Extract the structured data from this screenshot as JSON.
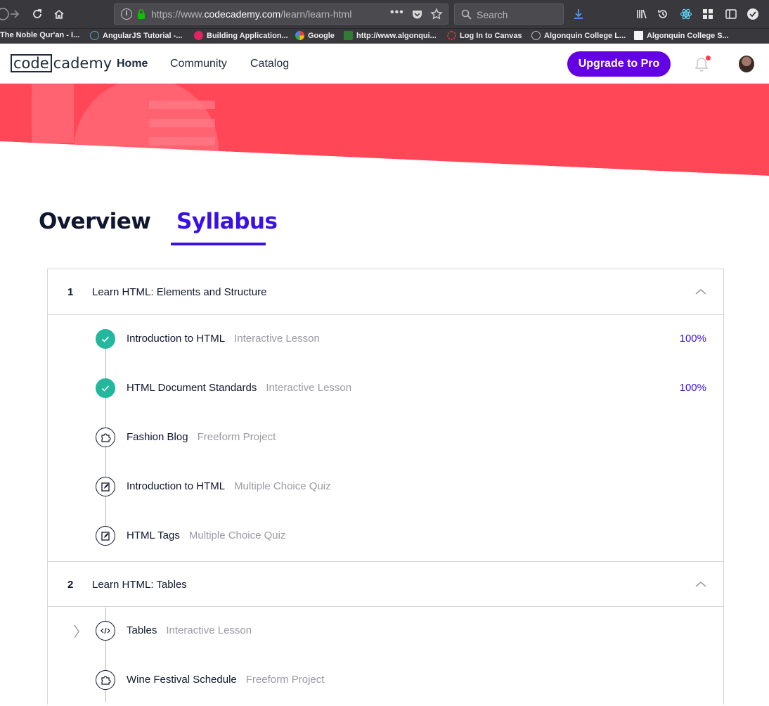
{
  "browser": {
    "url_prefix": "https://www.",
    "url_domain": "codecademy.com",
    "url_path": "/learn/learn-html",
    "search_placeholder": "Search"
  },
  "bookmarks": [
    {
      "label": "The Noble Qur'an - I...",
      "color": "#ffffff"
    },
    {
      "label": "AngularJS Tutorial -...",
      "color": "#5aa6c8"
    },
    {
      "label": "Building Application...",
      "color": "#e0245e"
    },
    {
      "label": "Google",
      "color": "#4285f4"
    },
    {
      "label": "http://www.algonqui...",
      "color": "#2e7d32"
    },
    {
      "label": "Log In to Canvas",
      "color": "#e53935"
    },
    {
      "label": "Algonquin College L...",
      "color": "#bdbdbd"
    },
    {
      "label": "Algonquin College S...",
      "color": "#f5f5f5"
    }
  ],
  "header": {
    "logo_box": "code",
    "logo_rest": "cademy",
    "nav": [
      "Home",
      "Community",
      "Catalog"
    ],
    "upgrade_label": "Upgrade to Pro",
    "accent": "#6400e4"
  },
  "tabs": {
    "overview": "Overview",
    "syllabus": "Syllabus"
  },
  "modules": [
    {
      "number": "1",
      "title": "Learn HTML: Elements and Structure",
      "items": [
        {
          "title": "Introduction to HTML",
          "type": "Interactive Lesson",
          "progress": "100%",
          "icon": "check-icon",
          "status": "complete"
        },
        {
          "title": "HTML Document Standards",
          "type": "Interactive Lesson",
          "progress": "100%",
          "icon": "check-icon",
          "status": "complete"
        },
        {
          "title": "Fashion Blog",
          "type": "Freeform Project",
          "progress": "",
          "icon": "puzzle-icon",
          "status": "incomplete"
        },
        {
          "title": "Introduction to HTML",
          "type": "Multiple Choice Quiz",
          "progress": "",
          "icon": "quiz-icon",
          "status": "incomplete"
        },
        {
          "title": "HTML Tags",
          "type": "Multiple Choice Quiz",
          "progress": "",
          "icon": "quiz-icon",
          "status": "incomplete"
        }
      ]
    },
    {
      "number": "2",
      "title": "Learn HTML: Tables",
      "items": [
        {
          "title": "Tables",
          "type": "Interactive Lesson",
          "progress": "",
          "icon": "code-icon",
          "status": "current"
        },
        {
          "title": "Wine Festival Schedule",
          "type": "Freeform Project",
          "progress": "",
          "icon": "puzzle-icon",
          "status": "incomplete"
        }
      ]
    }
  ],
  "colors": {
    "hero": "#ff4757",
    "syllabus_accent": "#3a10e5",
    "complete": "#23b89d"
  }
}
